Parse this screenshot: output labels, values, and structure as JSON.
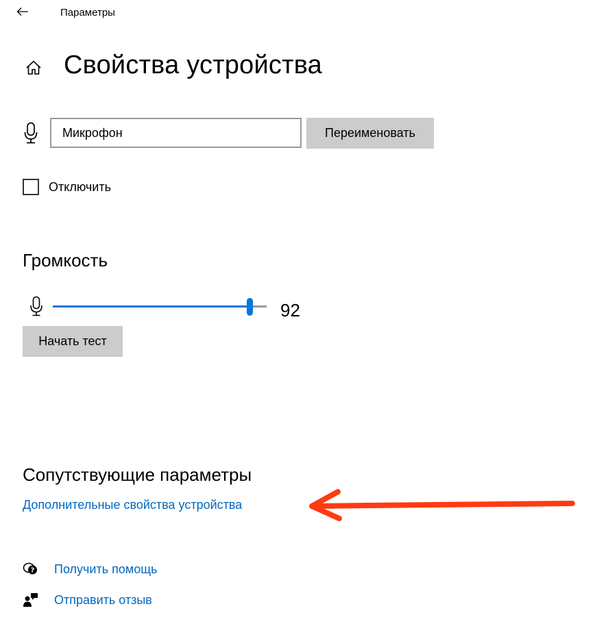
{
  "window": {
    "title": "Параметры"
  },
  "header": {
    "back_icon": "back-arrow-icon",
    "home_icon": "home-icon",
    "title": "Свойства устройства"
  },
  "device": {
    "icon": "microphone-icon",
    "name_value": "Микрофон",
    "rename_label": "Переименовать",
    "disable_label": "Отключить",
    "disable_checked": false
  },
  "volume": {
    "heading": "Громкость",
    "icon": "microphone-icon",
    "value": 92,
    "value_text": "92",
    "test_label": "Начать тест"
  },
  "related": {
    "heading": "Сопутствующие параметры",
    "device_props_link": "Дополнительные свойства устройства"
  },
  "help": {
    "get_help_label": "Получить помощь",
    "get_help_icon": "help-chat-icon",
    "feedback_label": "Отправить отзыв",
    "feedback_icon": "feedback-icon"
  },
  "colors": {
    "accent": "#0078d7",
    "link": "#0067c0",
    "button_bg": "#cccccc",
    "annotation_arrow": "#ff3b12"
  }
}
